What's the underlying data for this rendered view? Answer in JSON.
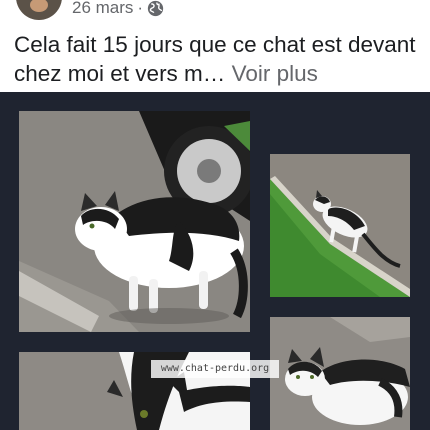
{
  "post": {
    "date": "26 mars",
    "separator": "·",
    "text": "Cela fait 15 jours que ce chat est devant chez moi et vers m…",
    "see_more": "Voir plus",
    "privacy_icon": "globe-icon"
  },
  "gallery": {
    "photos": [
      {
        "name": "photo-cat-by-car",
        "subject": "black and white cat on asphalt next to a car wheel"
      },
      {
        "name": "photo-cat-on-grass",
        "subject": "black and white cat walking on grass slope"
      },
      {
        "name": "photo-cat-closeup",
        "subject": "cat close-up on asphalt"
      },
      {
        "name": "photo-cat-standing",
        "subject": "cat standing on pavement"
      }
    ],
    "watermark": "www.chat-perdu.org"
  },
  "colors": {
    "gallery_bg": "#1f2430",
    "text": "#1c1e21",
    "muted": "#65676b"
  }
}
